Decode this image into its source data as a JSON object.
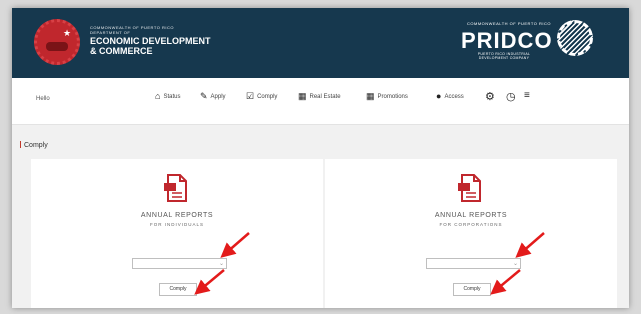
{
  "header": {
    "left_logo": {
      "line1": "COMMONWEALTH OF PUERTO RICO",
      "line2": "DEPARTMENT OF",
      "line3": "ECONOMIC DEVELOPMENT",
      "line4": "& COMMERCE"
    },
    "right_logo": {
      "top": "COMMONWEALTH OF PUERTO RICO",
      "name": "PRIDCO",
      "sub": "PUERTO RICO INDUSTRIAL DEVELOPMENT COMPANY"
    }
  },
  "nav": {
    "greeting": "Hello",
    "items": [
      {
        "label": "Status",
        "icon": "home-icon"
      },
      {
        "label": "Apply",
        "icon": "edit-icon"
      },
      {
        "label": "Comply",
        "icon": "checklist-icon"
      },
      {
        "label": "Real Estate",
        "icon": "building-icon"
      },
      {
        "label": "Promotions",
        "icon": "promotions-icon"
      },
      {
        "label": "Access",
        "icon": "access-icon"
      }
    ],
    "extra_icons": [
      "settings-icon",
      "clock-icon",
      "menu-icon"
    ]
  },
  "breadcrumb": "Comply",
  "cards": [
    {
      "title": "ANNUAL REPORTS",
      "subtitle": "FOR INDIVIDUALS",
      "select_value": "",
      "button": "Comply"
    },
    {
      "title": "ANNUAL REPORTS",
      "subtitle": "FOR CORPORATIONS",
      "select_value": "",
      "button": "Comply"
    }
  ],
  "colors": {
    "banner": "#16384e",
    "accent_red": "#c0272d",
    "arrow_red": "#e31b1b"
  }
}
